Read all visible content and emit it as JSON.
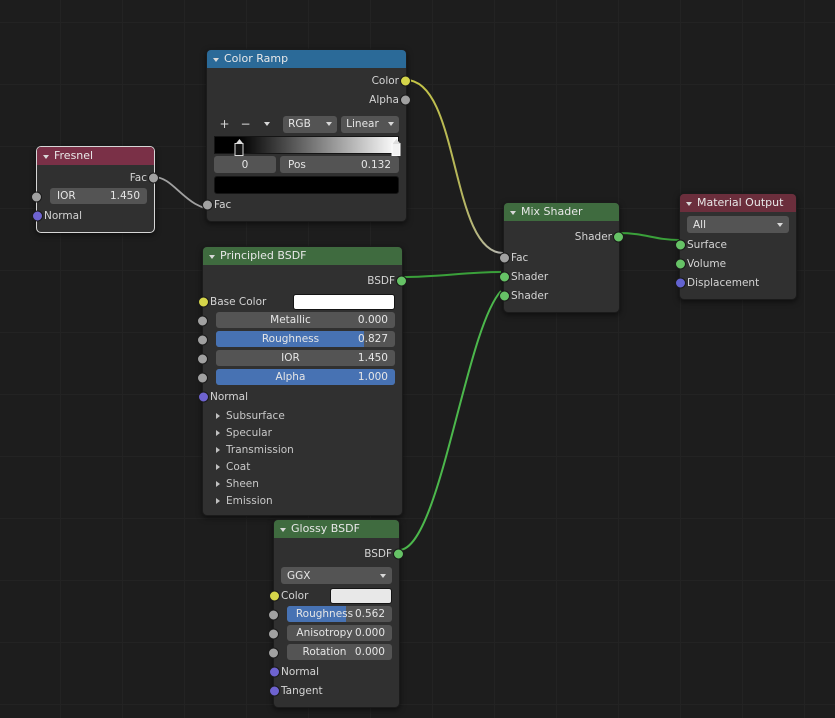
{
  "editor": {
    "name": "shader-node-editor",
    "background": "#1d1d1d",
    "grid_color": "#232323"
  },
  "nodes": {
    "fresnel": {
      "title": "Fresnel",
      "header_color": "#7a3047",
      "outputs": [
        {
          "label": "Fac",
          "socket": "gray"
        }
      ],
      "fields": [
        {
          "name": "IOR",
          "value": "1.450"
        }
      ],
      "inputs": [
        {
          "label": "Normal",
          "socket": "purple"
        }
      ],
      "selected": true
    },
    "color_ramp": {
      "title": "Color Ramp",
      "header_color": "#2b6a98",
      "outputs": [
        {
          "label": "Color",
          "socket": "yellow"
        },
        {
          "label": "Alpha",
          "socket": "gray"
        }
      ],
      "tools": {
        "add": "+",
        "remove": "−",
        "menu": "v"
      },
      "color_mode": "RGB",
      "interpolation": "Linear",
      "ramp": {
        "stops": [
          {
            "position": 0.132,
            "color": "#000000",
            "selected": true
          },
          {
            "position": 1.0,
            "color": "#ffffff",
            "selected": false
          }
        ]
      },
      "index_value": "0",
      "pos_label": "Pos",
      "pos_value": "0.132",
      "selected_stop_color": "#000000",
      "inputs": [
        {
          "label": "Fac",
          "socket": "gray"
        }
      ]
    },
    "principled_bsdf": {
      "title": "Principled BSDF",
      "header_color": "#3f6b3f",
      "outputs": [
        {
          "label": "BSDF",
          "socket": "shader"
        }
      ],
      "base_color": {
        "label": "Base Color",
        "socket": "yellow",
        "swatch": "#ffffff"
      },
      "sliders": [
        {
          "name": "Metallic",
          "value": "0.000",
          "fill": 0.0,
          "active": false
        },
        {
          "name": "Roughness",
          "value": "0.827",
          "fill": 0.827,
          "active": true
        },
        {
          "name": "IOR",
          "value": "1.450",
          "fill": 0.0,
          "active": false
        },
        {
          "name": "Alpha",
          "value": "1.000",
          "fill": 1.0,
          "active": true
        }
      ],
      "normal": {
        "label": "Normal",
        "socket": "purple"
      },
      "panels": [
        "Subsurface",
        "Specular",
        "Transmission",
        "Coat",
        "Sheen",
        "Emission"
      ]
    },
    "mix_shader": {
      "title": "Mix Shader",
      "header_color": "#3f6b3f",
      "outputs": [
        {
          "label": "Shader",
          "socket": "shader"
        }
      ],
      "inputs": [
        {
          "label": "Fac",
          "socket": "gray"
        },
        {
          "label": "Shader",
          "socket": "shader"
        },
        {
          "label": "Shader",
          "socket": "shader"
        }
      ]
    },
    "material_output": {
      "title": "Material Output",
      "header_color": "#6b2e3c",
      "target": "All",
      "inputs": [
        {
          "label": "Surface",
          "socket": "shader"
        },
        {
          "label": "Volume",
          "socket": "shader"
        },
        {
          "label": "Displacement",
          "socket": "blue"
        }
      ]
    },
    "glossy_bsdf": {
      "title": "Glossy BSDF",
      "header_color": "#3f6b3f",
      "outputs": [
        {
          "label": "BSDF",
          "socket": "shader"
        }
      ],
      "distribution": "GGX",
      "color": {
        "label": "Color",
        "socket": "yellow",
        "swatch": "#e8e8e8"
      },
      "sliders": [
        {
          "name": "Roughness",
          "value": "0.562",
          "fill": 0.562,
          "active": true
        },
        {
          "name": "Anisotropy",
          "value": "0.000",
          "fill": 0.0,
          "active": false
        },
        {
          "name": "Rotation",
          "value": "0.000",
          "fill": 0.0,
          "active": false
        }
      ],
      "inputs": [
        {
          "label": "Normal",
          "socket": "purple"
        },
        {
          "label": "Tangent",
          "socket": "purple"
        }
      ]
    }
  },
  "links": [
    {
      "from": "fresnel.Fac",
      "to": "color_ramp.Fac",
      "color_from": "#a1a1a1",
      "color_to": "#a1a1a1"
    },
    {
      "from": "color_ramp.Color",
      "to": "mix_shader.Fac",
      "color_from": "#d5d54a",
      "color_to": "#a1a1a1"
    },
    {
      "from": "principled_bsdf.BSDF",
      "to": "mix_shader.Shader1",
      "color_from": "#3ba23b",
      "color_to": "#3ba23b"
    },
    {
      "from": "glossy_bsdf.BSDF",
      "to": "mix_shader.Shader2",
      "color_from": "#55bb55",
      "color_to": "#55bb55"
    },
    {
      "from": "mix_shader.Shader",
      "to": "material_output.Surface",
      "color_from": "#3ba23b",
      "color_to": "#3ba23b"
    }
  ]
}
